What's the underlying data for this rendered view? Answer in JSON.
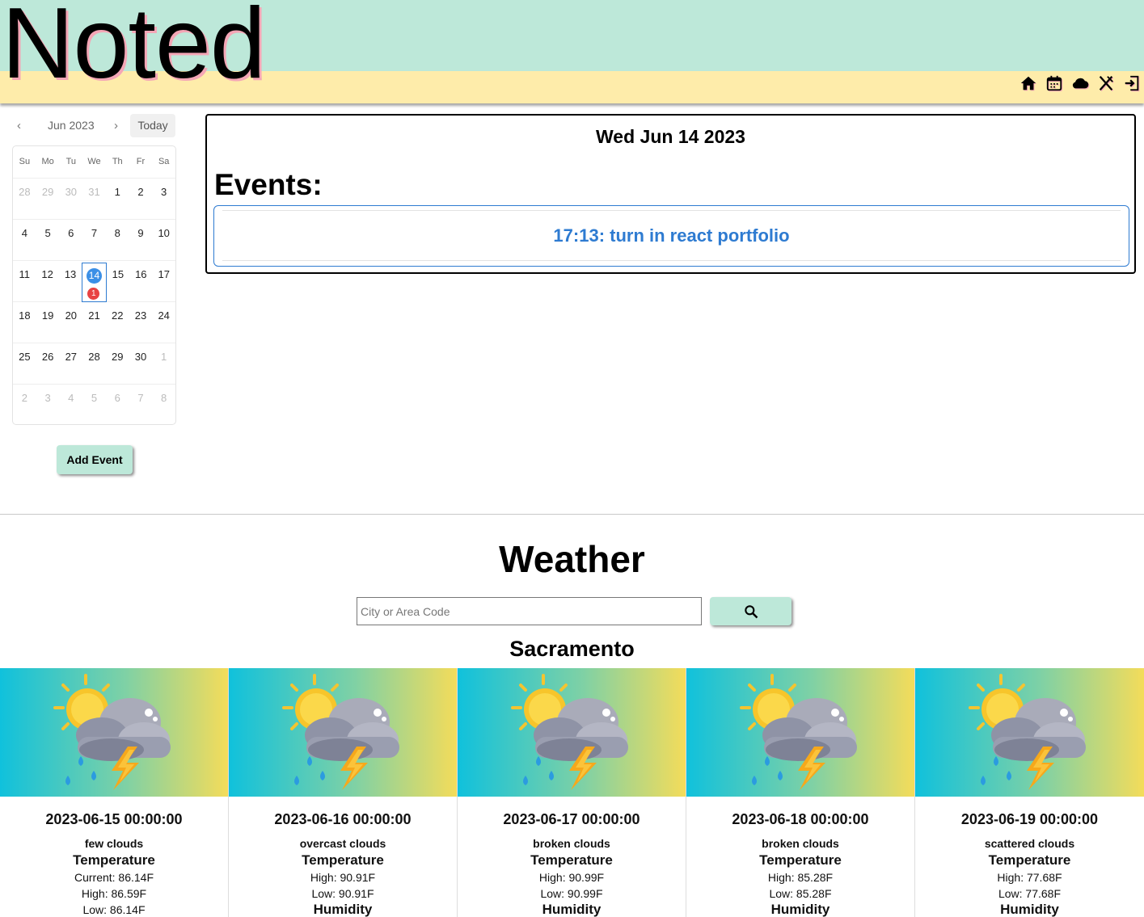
{
  "brand": "Noted",
  "nav": [
    "home-icon",
    "calendar-icon",
    "cloud-icon",
    "utensils-icon",
    "logout-icon"
  ],
  "calendar": {
    "month_label": "Jun 2023",
    "prev": "‹",
    "next": "›",
    "today_label": "Today",
    "weekdays": [
      "Su",
      "Mo",
      "Tu",
      "We",
      "Th",
      "Fr",
      "Sa"
    ],
    "weeks": [
      [
        {
          "d": "28",
          "m": true
        },
        {
          "d": "29",
          "m": true
        },
        {
          "d": "30",
          "m": true
        },
        {
          "d": "31",
          "m": true
        },
        {
          "d": "1"
        },
        {
          "d": "2"
        },
        {
          "d": "3"
        }
      ],
      [
        {
          "d": "4"
        },
        {
          "d": "5"
        },
        {
          "d": "6"
        },
        {
          "d": "7"
        },
        {
          "d": "8"
        },
        {
          "d": "9"
        },
        {
          "d": "10"
        }
      ],
      [
        {
          "d": "11"
        },
        {
          "d": "12"
        },
        {
          "d": "13"
        },
        {
          "d": "14",
          "sel": true,
          "badge": "1"
        },
        {
          "d": "15"
        },
        {
          "d": "16"
        },
        {
          "d": "17"
        }
      ],
      [
        {
          "d": "18"
        },
        {
          "d": "19"
        },
        {
          "d": "20"
        },
        {
          "d": "21"
        },
        {
          "d": "22"
        },
        {
          "d": "23"
        },
        {
          "d": "24"
        }
      ],
      [
        {
          "d": "25"
        },
        {
          "d": "26"
        },
        {
          "d": "27"
        },
        {
          "d": "28"
        },
        {
          "d": "29"
        },
        {
          "d": "30"
        },
        {
          "d": "1",
          "m": true
        }
      ],
      [
        {
          "d": "2",
          "m": true
        },
        {
          "d": "3",
          "m": true
        },
        {
          "d": "4",
          "m": true
        },
        {
          "d": "5",
          "m": true
        },
        {
          "d": "6",
          "m": true
        },
        {
          "d": "7",
          "m": true
        },
        {
          "d": "8",
          "m": true
        }
      ]
    ],
    "add_event_label": "Add Event"
  },
  "events": {
    "date": "Wed Jun 14 2023",
    "title": "Events:",
    "items": [
      "17:13: turn in react portfolio"
    ]
  },
  "weather": {
    "title": "Weather",
    "search_placeholder": "City or Area Code",
    "search_value": "",
    "search_icon": "search-icon",
    "city": "Sacramento",
    "forecast": [
      {
        "date": "2023-06-15 00:00:00",
        "desc": "few clouds",
        "temp_label": "Temperature",
        "l1": "Current: 86.14F",
        "l2": "High: 86.59F",
        "l3": "Low: 86.14F"
      },
      {
        "date": "2023-06-16 00:00:00",
        "desc": "overcast clouds",
        "temp_label": "Temperature",
        "l1": "High: 90.91F",
        "l2": "Low: 90.91F",
        "l3": "Humidity"
      },
      {
        "date": "2023-06-17 00:00:00",
        "desc": "broken clouds",
        "temp_label": "Temperature",
        "l1": "High: 90.99F",
        "l2": "Low: 90.99F",
        "l3": "Humidity"
      },
      {
        "date": "2023-06-18 00:00:00",
        "desc": "broken clouds",
        "temp_label": "Temperature",
        "l1": "High: 85.28F",
        "l2": "Low: 85.28F",
        "l3": "Humidity"
      },
      {
        "date": "2023-06-19 00:00:00",
        "desc": "scattered clouds",
        "temp_label": "Temperature",
        "l1": "High: 77.68F",
        "l2": "Low: 77.68F",
        "l3": "Humidity"
      }
    ]
  },
  "colors": {
    "header_mint": "#bde8d9",
    "header_yellow": "#feecaa",
    "accent_blue": "#2e7bd1",
    "badge_red": "#e84343"
  }
}
